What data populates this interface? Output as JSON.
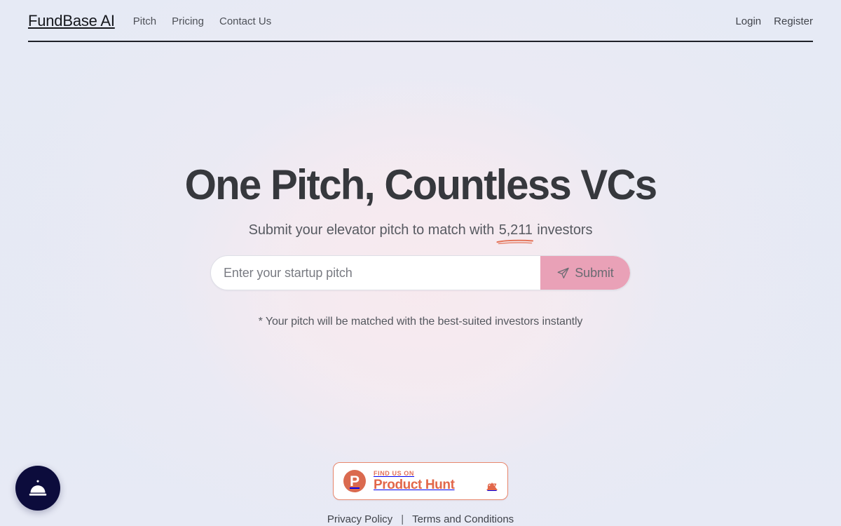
{
  "nav": {
    "brand": "FundBase AI",
    "links": [
      {
        "label": "Pitch"
      },
      {
        "label": "Pricing"
      },
      {
        "label": "Contact Us"
      }
    ],
    "auth": [
      {
        "label": "Login"
      },
      {
        "label": "Register"
      }
    ]
  },
  "hero": {
    "headline": "One Pitch, Countless VCs",
    "sub_prefix": "Submit your elevator pitch to match with ",
    "investor_count": "5,211",
    "sub_suffix": " investors",
    "footnote": "* Your pitch will be matched with the best-suited investors instantly"
  },
  "search": {
    "placeholder": "Enter your startup pitch",
    "value": "",
    "submit_label": "Submit",
    "submit_icon": "send-icon"
  },
  "product_hunt": {
    "kicker": "FIND US ON",
    "name": "Product Hunt",
    "logo_letter": "P",
    "upvotes": "67"
  },
  "footer": {
    "privacy": "Privacy Policy",
    "separator": "|",
    "terms": "Terms and Conditions"
  },
  "fab": {
    "icon": "service-bell-icon"
  },
  "colors": {
    "page_background": "#e5e9f4",
    "center_glow": "#f7eef2",
    "headline": "#36383d",
    "submit_pink": "#e9a1b7",
    "underline_coral": "#e4745a",
    "product_hunt_coral": "#e2674a",
    "fab_navy": "#0c0c3c",
    "nav_border": "#1f2128"
  }
}
